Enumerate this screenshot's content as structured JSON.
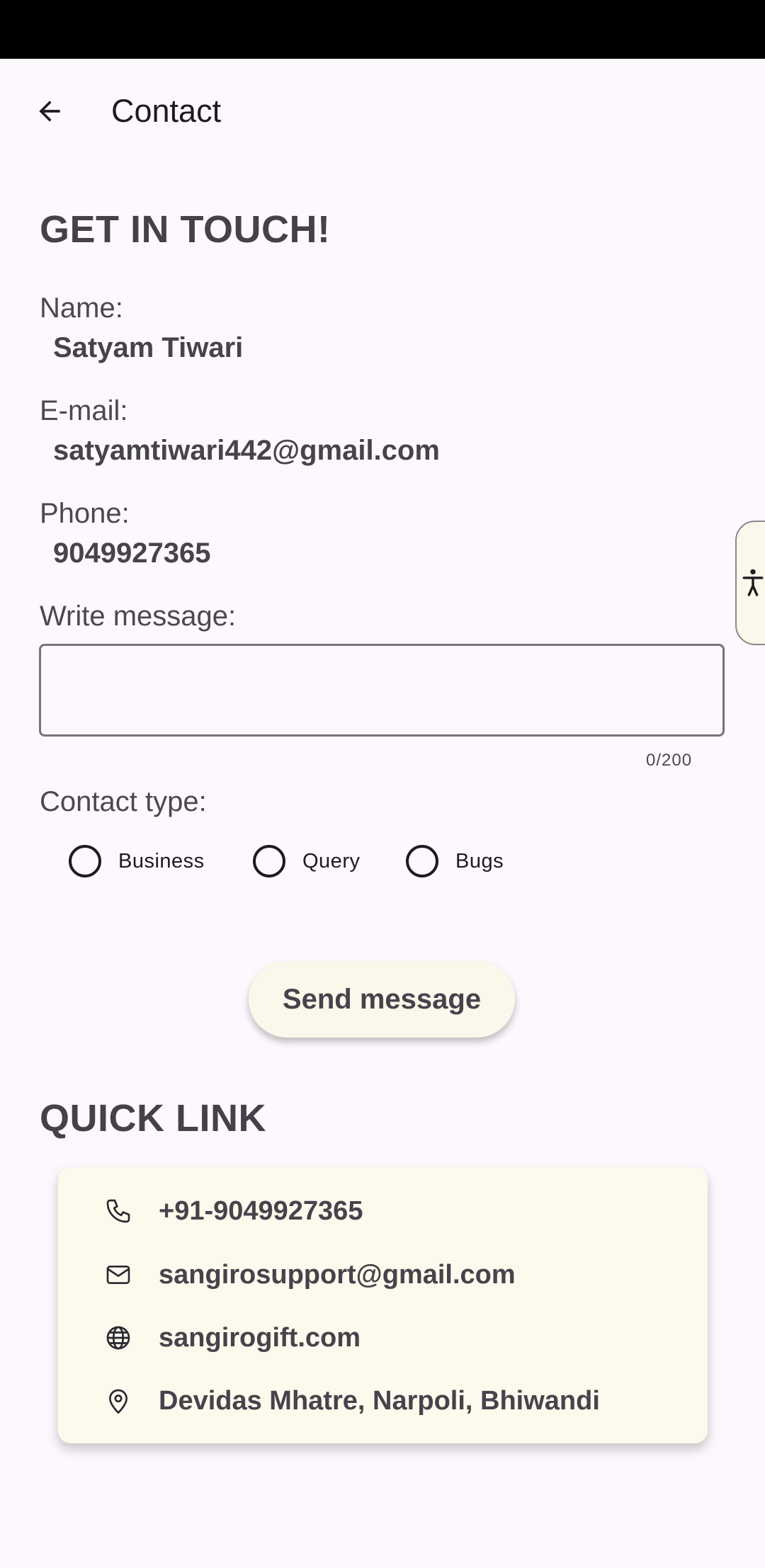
{
  "app_bar": {
    "title": "Contact"
  },
  "contact_form": {
    "heading": "GET IN TOUCH!",
    "name_label": "Name:",
    "name_value": "Satyam Tiwari",
    "email_label": "E-mail:",
    "email_value": "satyamtiwari442@gmail.com",
    "phone_label": "Phone:",
    "phone_value": "9049927365",
    "message_label": "Write message:",
    "message_value": "",
    "message_counter": "0/200",
    "contact_type_label": "Contact type:",
    "contact_types": [
      {
        "label": "Business",
        "selected": false
      },
      {
        "label": "Query",
        "selected": false
      },
      {
        "label": "Bugs",
        "selected": false
      }
    ],
    "send_label": "Send message"
  },
  "quick_link": {
    "heading": "QUICK LINK",
    "items": [
      {
        "icon": "phone-icon",
        "text": "+91-9049927365"
      },
      {
        "icon": "mail-icon",
        "text": "sangirosupport@gmail.com"
      },
      {
        "icon": "globe-icon",
        "text": "sangirogift.com"
      },
      {
        "icon": "location-pin-icon",
        "text": "Devidas Mhatre, Narpoli, Bhiwandi"
      }
    ]
  },
  "colors": {
    "background": "#fdf8fd",
    "card": "#fcfaed",
    "button": "#fbf7ea",
    "text": "#46434c"
  }
}
